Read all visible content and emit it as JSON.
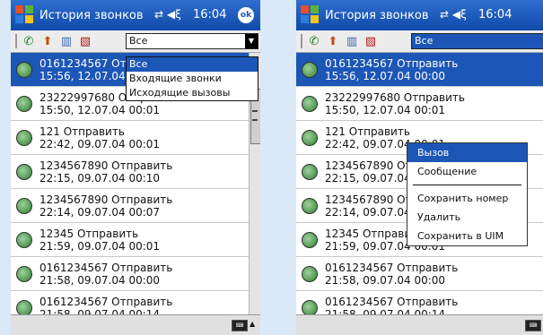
{
  "colors": {
    "accent": "#1c56b7",
    "titlebar": "#1c56b7",
    "background": "#d9e9f7"
  },
  "left": {
    "title": "История звонков",
    "time": "16:04",
    "ok": "ok",
    "filter_value": "Все",
    "dropdown_options": [
      "Все",
      "Входящие звонки",
      "Исходящие вызовы"
    ],
    "selected_option": 0,
    "rows": [
      {
        "line1": "0161234567 Отправить",
        "line2": "15:56, 12.07.04 00:00"
      },
      {
        "line1": "23222997680 Отправить",
        "line2": "15:50, 12.07.04 00:01"
      },
      {
        "line1": "121 Отправить",
        "line2": "22:42, 09.07.04 00:01"
      },
      {
        "line1": "1234567890 Отправить",
        "line2": "22:15, 09.07.04 00:10"
      },
      {
        "line1": "1234567890 Отправить",
        "line2": "22:14, 09.07.04 00:07"
      },
      {
        "line1": "12345 Отправить",
        "line2": "21:59, 09.07.04 00:01"
      },
      {
        "line1": "0161234567 Отправить",
        "line2": "21:58, 09.07.04 00:00"
      },
      {
        "line1": "0161234567 Отправить",
        "line2": "21:58, 09.07.04 00:14"
      }
    ]
  },
  "right": {
    "title": "История звонков",
    "time": "16:04",
    "filter_value": "Все",
    "rows": [
      {
        "line1": "0161234567 Отправить",
        "line2": "15:56, 12.07.04 00:00"
      },
      {
        "line1": "23222997680 Отправить",
        "line2": "15:50, 12.07.04 00:01"
      },
      {
        "line1": "121 Отправить",
        "line2": "22:42, 09.07.04 00:01"
      },
      {
        "line1": "1234567890 Отправить",
        "line2": "22:15, 09.07.04 00:10"
      },
      {
        "line1": "1234567890 Отправить",
        "line2": "22:14, 09.07.04 00:07"
      },
      {
        "line1": "12345 Отправить",
        "line2": "21:59, 09.07.04 00:01"
      },
      {
        "line1": "0161234567 Отправить",
        "line2": "21:58, 09.07.04 00:00"
      },
      {
        "line1": "0161234567 Отправить",
        "line2": "21:58, 09.07.04 00:14"
      }
    ],
    "context_menu": [
      "Вызов",
      "Сообщение",
      "Сохранить номер",
      "Удалить",
      "Сохранить в UIM"
    ],
    "context_selected": 0
  },
  "icons": {
    "start": "windows-flag-icon",
    "connectivity": "connectivity-icon",
    "volume": "volume-icon",
    "call": "call-icon",
    "save": "save-contact-icon",
    "delete": "delete-icon",
    "delete_all": "delete-all-icon",
    "keyboard": "keyboard-icon"
  }
}
